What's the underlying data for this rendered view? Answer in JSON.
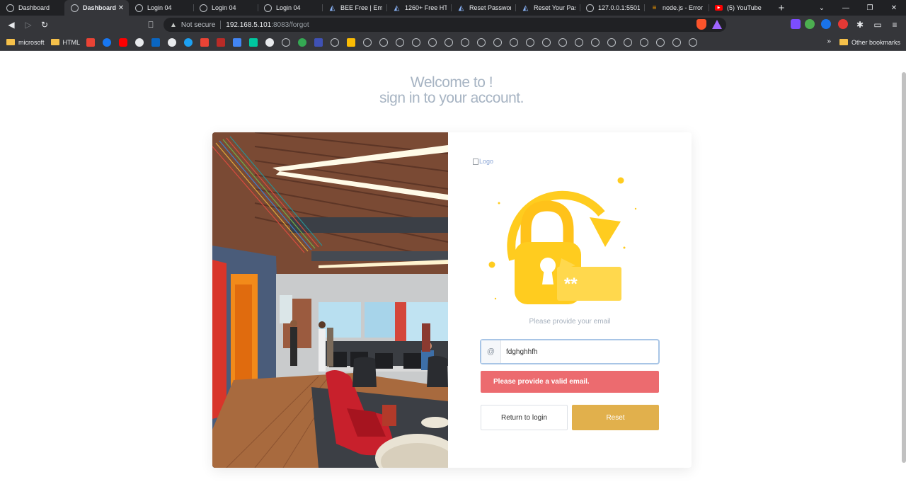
{
  "browser": {
    "tabs": [
      {
        "title": "Dashboard",
        "icon": "globe",
        "active": false
      },
      {
        "title": "Dashboard",
        "icon": "globe",
        "active": true
      },
      {
        "title": "Login 04",
        "icon": "globe",
        "active": false
      },
      {
        "title": "Login 04",
        "icon": "globe",
        "active": false
      },
      {
        "title": "Login 04",
        "icon": "globe",
        "active": false
      },
      {
        "title": "BEE Free | Email",
        "icon": "bee",
        "active": false
      },
      {
        "title": "1260+ Free HTM",
        "icon": "bee",
        "active": false
      },
      {
        "title": "Reset Password",
        "icon": "bee",
        "active": false
      },
      {
        "title": "Reset Your Passw",
        "icon": "bee",
        "active": false
      },
      {
        "title": "127.0.0.1:5501/h",
        "icon": "globe",
        "active": false
      },
      {
        "title": "node.js - Error n",
        "icon": "node",
        "active": false
      },
      {
        "title": "(5) YouTube",
        "icon": "youtube",
        "active": false
      }
    ],
    "address": {
      "security_label": "Not secure",
      "host": "192.168.5.101",
      "path": ":8083/forgot"
    },
    "bookmarks": {
      "items": [
        {
          "label": "microsoft"
        },
        {
          "label": "HTML"
        }
      ],
      "more_label": "»",
      "other_label": "Other bookmarks"
    }
  },
  "page": {
    "heading_line1": "Welcome to !",
    "heading_line2": "sign in to your account.",
    "logo_alt": "Logo",
    "hint": "Please provide your email",
    "email": {
      "prefix": "@",
      "value": "fdghghhfh"
    },
    "alert": "Please provide a valid email.",
    "return_label": "Return to login",
    "reset_label": "Reset"
  },
  "colors": {
    "heading": "#a7b4c3",
    "alert_bg": "#ec6b6f",
    "reset_bg": "#e1b04c",
    "illustration": "#ffcc1f"
  }
}
